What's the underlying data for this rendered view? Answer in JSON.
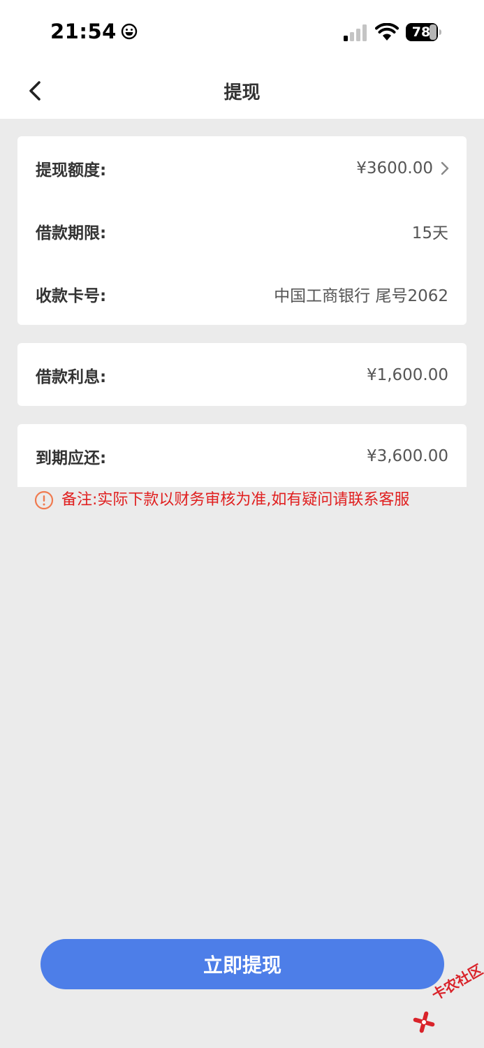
{
  "status_bar": {
    "time": "21:54",
    "battery": "78"
  },
  "nav": {
    "title": "提现"
  },
  "details": {
    "limit_label": "提现额度:",
    "limit_value": "¥3600.00",
    "term_label": "借款期限:",
    "term_value": "15天",
    "card_label": "收款卡号:",
    "card_value": "中国工商银行 尾号2062"
  },
  "interest": {
    "label": "借款利息:",
    "value": "¥1,600.00"
  },
  "due": {
    "label": "到期应还:",
    "value": "¥3,600.00"
  },
  "note": {
    "text": "备注:实际下款以财务审核为准,如有疑问请联系客服"
  },
  "submit": {
    "label": "立即提现"
  },
  "watermark": {
    "text": "卡农社区"
  },
  "colors": {
    "primary_button": "#4d7ee8",
    "note_red": "#e02020",
    "warning_orange": "#f07a4f",
    "background": "#ebebeb"
  }
}
